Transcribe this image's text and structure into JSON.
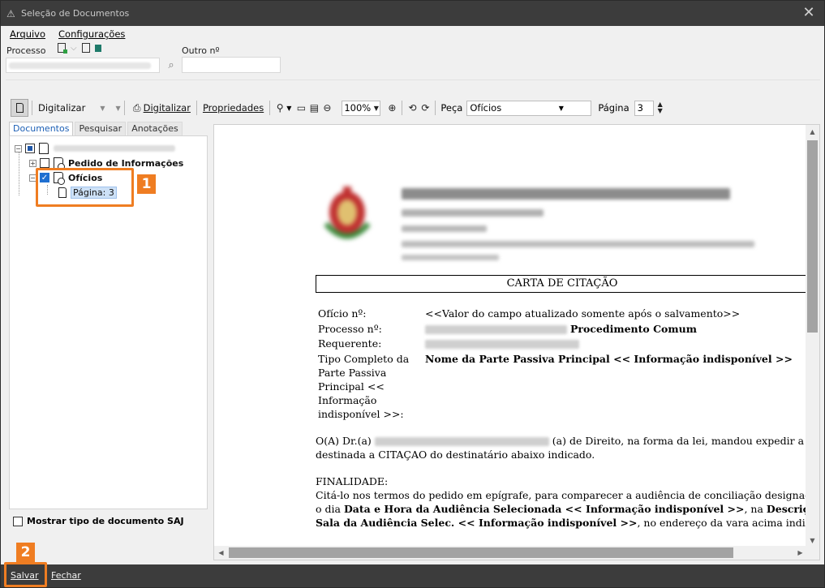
{
  "window": {
    "title": "Seleção de Documentos"
  },
  "menu": {
    "items": [
      "Arquivo",
      "Configurações"
    ]
  },
  "process": {
    "process_label": "Processo",
    "other_label": "Outro nº",
    "other_value": ""
  },
  "toolbar": {
    "scan_label": "Digitalizar",
    "scan2_label": "Digitalizar",
    "properties_label": "Propriedades",
    "zoom_value": "100%",
    "piece_label": "Peça",
    "piece_value": "Ofícios",
    "page_label": "Página",
    "page_value": "3"
  },
  "tabs": [
    "Documentos",
    "Pesquisar",
    "Anotações"
  ],
  "tree": {
    "node1_label": "Pedido de Informações",
    "node2_label": "Ofícios",
    "page_label": "Página: 3"
  },
  "callouts": {
    "one": "1",
    "two": "2"
  },
  "options": {
    "show_type_label": "Mostrar tipo de documento SAJ"
  },
  "document": {
    "title": "CARTA DE CITAÇÃO",
    "fields": [
      {
        "label": "Ofício nº:",
        "value": "<<Valor do campo atualizado somente após o salvamento>>"
      },
      {
        "label": "Processo nº:",
        "value": "Procedimento Comum"
      },
      {
        "label": "Requerente:",
        "value": ""
      },
      {
        "label": "Tipo Completo da",
        "value": "Nome da Parte Passiva Principal << Informação indisponível >>"
      }
    ],
    "field_wrap": [
      "Parte Passiva",
      "Principal <<",
      "Informação",
      "indisponível >>:"
    ],
    "para1_start": "O(A) Dr.(a)",
    "para1_end": "(a) de Direito, na forma da lei, mandou expedir a presente carta,",
    "para1_line2": "destinada a CITAÇAO do destinatário abaixo indicado.",
    "finalidade_label": "FINALIDADE:",
    "fin_line1": "Citá-lo nos termos do pedido em epígrafe, para comparecer a audiência de conciliação designada para",
    "fin_l2_a": "o dia ",
    "fin_l2_b": "Data e Hora da Audiência Selecionada << Informação indisponível >>",
    "fin_l2_c": ", na ",
    "fin_l2_d": "Descrição da",
    "fin_l3_a": "Sala da Audiência Selec. << Informação indisponível >>",
    "fin_l3_b": ", no endereço da vara acima indicado."
  },
  "footer": {
    "save_label": "Salvar",
    "close_label": "Fechar"
  },
  "colors": {
    "callout": "#ef7d22",
    "titlebar": "#3c3c3c",
    "selection": "#cde1f7",
    "check": "#1f6fd1"
  },
  "icons": [
    "app-icon",
    "close-icon",
    "search-icon",
    "page-icon",
    "scan-icon",
    "zoom-icon",
    "fit-width-icon",
    "fit-page-icon",
    "zoom-out-icon",
    "zoom-in-icon",
    "rotate-left-icon",
    "rotate-right-icon",
    "spin-up-icon",
    "spin-down-icon"
  ]
}
